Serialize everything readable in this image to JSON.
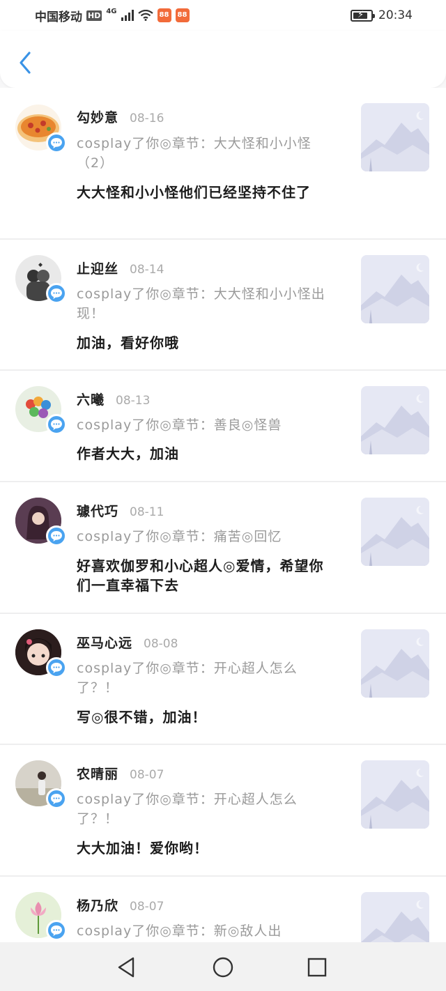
{
  "status_bar": {
    "carrier": "中国移动",
    "hd_label": "HD",
    "network": "4G",
    "app_badge_1": "88",
    "app_badge_2": "88",
    "time": "20:34",
    "battery_level": 0.85
  },
  "header": {
    "back_icon": "chevron-left-icon"
  },
  "colors": {
    "accent": "#4aa3f0",
    "name": "#222222",
    "meta": "#9a9a9a",
    "divider": "#eeeeef"
  },
  "comments": [
    {
      "name": "勾妙意",
      "date": "08-16",
      "quote": "cosplay了你◎章节：大大怪和小小怪（2）",
      "text": "大大怪和小小怪他们已经坚持不住了"
    },
    {
      "name": "止迎丝",
      "date": "08-14",
      "quote": "cosplay了你◎章节：大大怪和小小怪出现！",
      "text": "加油，看好你哦"
    },
    {
      "name": "六曦",
      "date": "08-13",
      "quote": "cosplay了你◎章节：善良◎怪兽",
      "text": "作者大大，加油"
    },
    {
      "name": "璩代巧",
      "date": "08-11",
      "quote": "cosplay了你◎章节：痛苦◎回忆",
      "text": "好喜欢伽罗和小心超人◎爱情，希望你们一直幸福下去"
    },
    {
      "name": "巫马心远",
      "date": "08-08",
      "quote": "cosplay了你◎章节：开心超人怎么了？！",
      "text": "写◎很不错，加油！"
    },
    {
      "name": "农晴丽",
      "date": "08-07",
      "quote": "cosplay了你◎章节：开心超人怎么了？！",
      "text": "大大加油！爱你哟！"
    },
    {
      "name": "杨乃欣",
      "date": "08-07",
      "quote": "cosplay了你◎章节：新◎敌人出",
      "text": ""
    }
  ],
  "nav": {
    "back": "triangle-back-icon",
    "home": "circle-home-icon",
    "recents": "square-recents-icon"
  }
}
